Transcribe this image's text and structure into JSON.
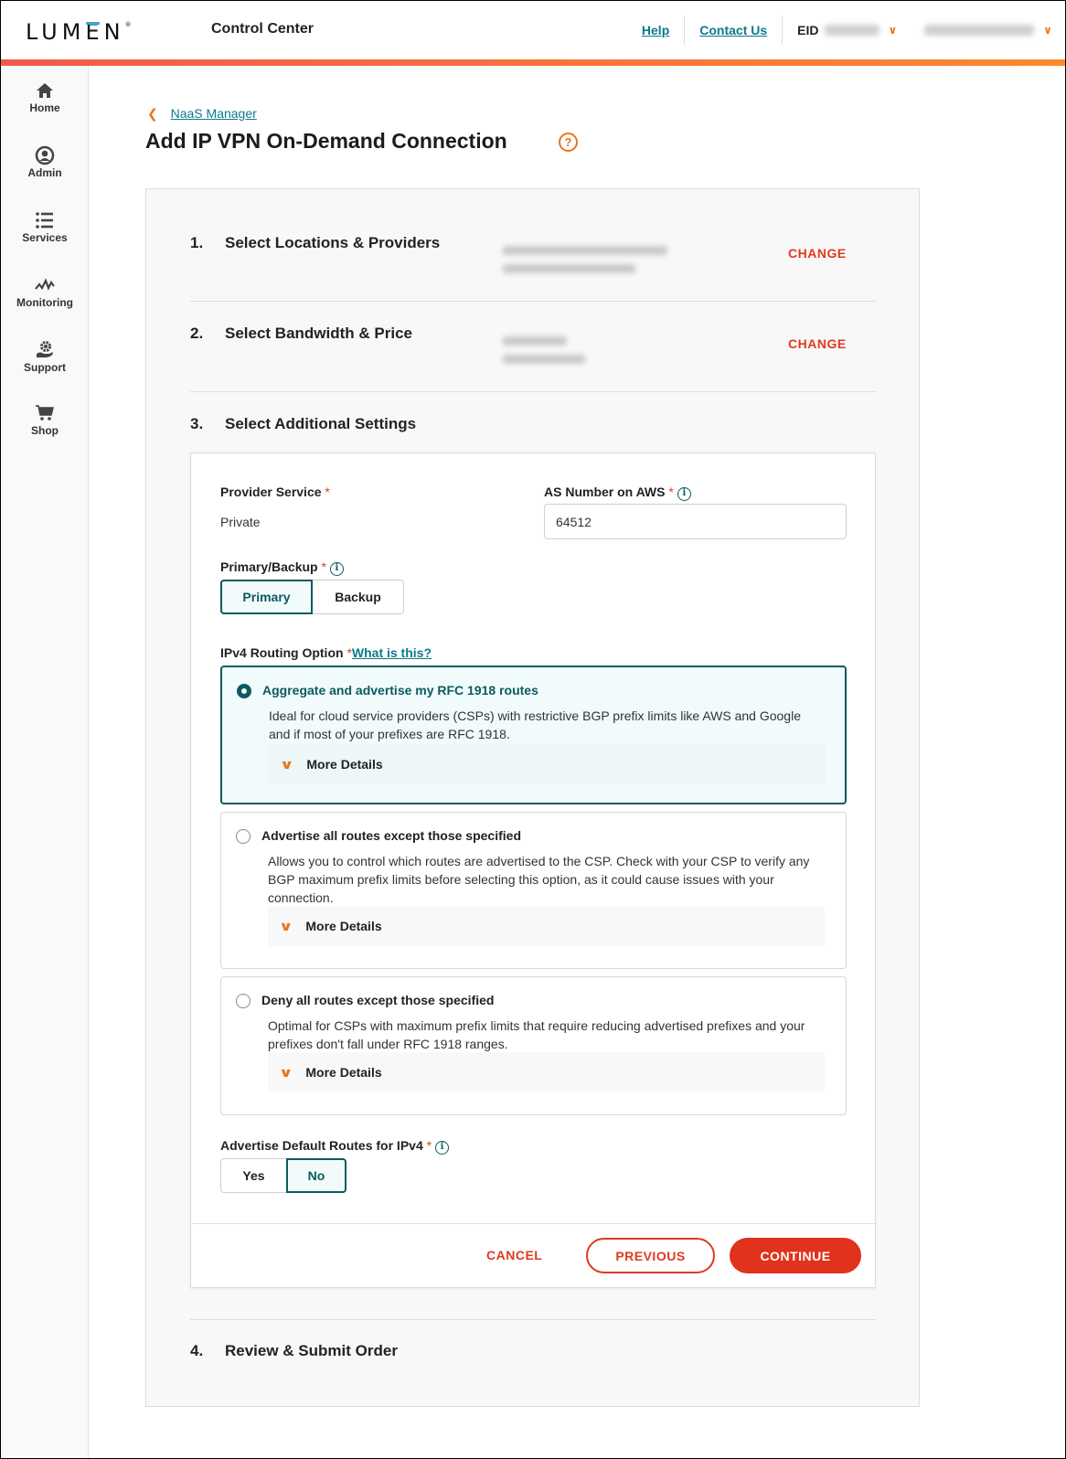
{
  "header": {
    "logo": "LUMEN",
    "app_title": "Control Center",
    "links": [
      "Help",
      "Contact Us"
    ],
    "eid_label": "EID",
    "brand_accent": "#e8761d"
  },
  "sidebar": {
    "items": [
      {
        "label": "Home",
        "icon": "home-icon"
      },
      {
        "label": "Admin",
        "icon": "user-circle-icon"
      },
      {
        "label": "Services",
        "icon": "list-icon"
      },
      {
        "label": "Monitoring",
        "icon": "pulse-icon"
      },
      {
        "label": "Support",
        "icon": "support-gear-hand-icon"
      },
      {
        "label": "Shop",
        "icon": "cart-icon"
      }
    ]
  },
  "breadcrumb": {
    "back_label": "NaaS Manager"
  },
  "page": {
    "title": "Add IP VPN On-Demand Connection",
    "help_glyph": "?"
  },
  "steps": [
    {
      "num": "1.",
      "title": "Select Locations & Providers",
      "action": "CHANGE"
    },
    {
      "num": "2.",
      "title": "Select Bandwidth & Price",
      "action": "CHANGE"
    },
    {
      "num": "3.",
      "title": "Select Additional Settings"
    },
    {
      "num": "4.",
      "title": "Review & Submit Order"
    }
  ],
  "form": {
    "provider_service": {
      "label": "Provider Service",
      "required": "*",
      "value": "Private"
    },
    "as_number": {
      "label": "AS Number on AWS",
      "required": "*",
      "value": "64512"
    },
    "primary_backup": {
      "label": "Primary/Backup",
      "required": "*",
      "options": [
        "Primary",
        "Backup"
      ],
      "selected": "Primary"
    },
    "routing": {
      "label": "IPv4 Routing Option",
      "required": "*",
      "help_link": "What is this?",
      "options": [
        {
          "title": "Aggregate and advertise my RFC 1918 routes",
          "desc": "Ideal for cloud service providers (CSPs) with restrictive BGP prefix limits like AWS and Google and if most of your prefixes are RFC 1918.",
          "details": "More Details",
          "selected": true
        },
        {
          "title": "Advertise all routes except those specified",
          "desc": "Allows you to control which routes are advertised to the CSP. Check with your CSP to verify any BGP maximum prefix limits before selecting this option, as it could cause issues with your connection.",
          "details": "More Details",
          "selected": false
        },
        {
          "title": "Deny all routes except those specified",
          "desc": "Optimal for CSPs with maximum prefix limits that require reducing advertised prefixes and your prefixes don't fall under RFC 1918 ranges.",
          "details": "More Details",
          "selected": false
        }
      ]
    },
    "default_routes": {
      "label": "Advertise Default Routes for IPv4",
      "required": "*",
      "options": [
        "Yes",
        "No"
      ],
      "selected": "No"
    }
  },
  "actions": {
    "cancel": "CANCEL",
    "previous": "PREVIOUS",
    "continue": "CONTINUE"
  },
  "colors": {
    "primary_red": "#e0321c",
    "teal": "#0b5a61",
    "link_teal": "#0c7a8a",
    "orange": "#e8761d"
  }
}
